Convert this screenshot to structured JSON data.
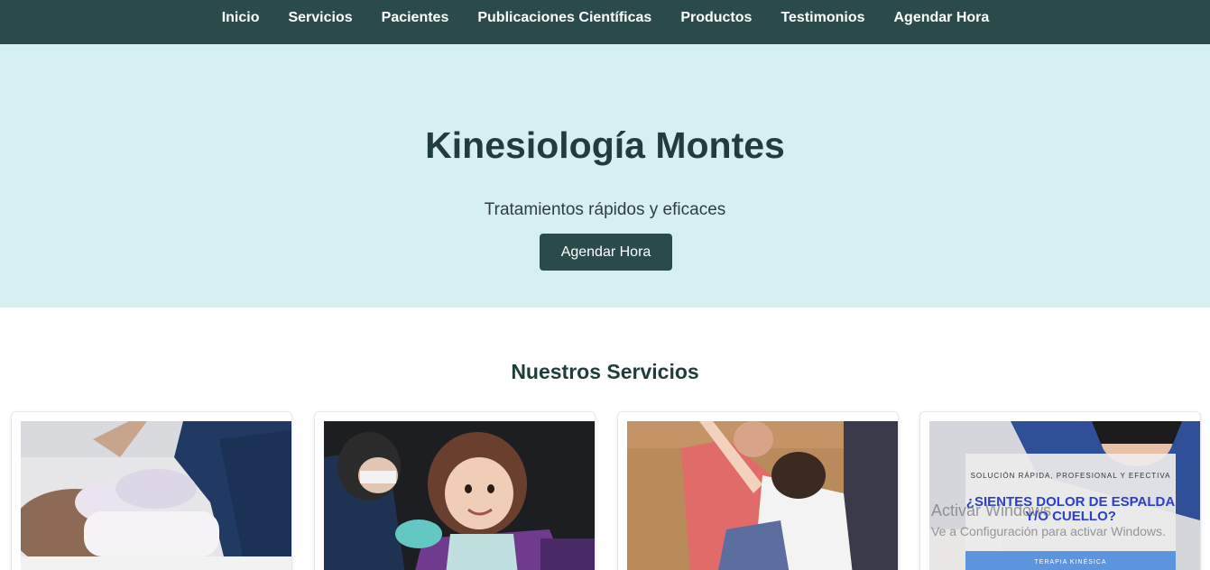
{
  "nav": {
    "items": [
      {
        "label": "Inicio"
      },
      {
        "label": "Servicios"
      },
      {
        "label": "Pacientes"
      },
      {
        "label": "Publicaciones Científicas"
      },
      {
        "label": "Productos"
      },
      {
        "label": "Testimonios"
      },
      {
        "label": "Agendar Hora"
      }
    ]
  },
  "hero": {
    "title": "Kinesiología Montes",
    "tagline": "Tratamientos rápidos y eficaces",
    "cta_label": "Agendar Hora"
  },
  "services": {
    "title": "Nuestros Servicios",
    "promo": {
      "small": "SOLUCIÓN RÁPIDA, PROFESIONAL Y EFECTIVA",
      "headline": "¿SIENTES DOLOR DE ESPALDA Y/O CUELLO?",
      "strip": "TERAPIA KINÉSICA"
    }
  },
  "system_overlay": {
    "line1": "Activar Windows",
    "line2": "Ve a Configuración para activar Windows."
  },
  "colors": {
    "nav_bg": "#2b4b4b",
    "hero_bg": "#d6eff0",
    "heading": "#1f3d3b",
    "button_bg": "#2b4b4b",
    "promo_headline": "#2a3ecf"
  }
}
